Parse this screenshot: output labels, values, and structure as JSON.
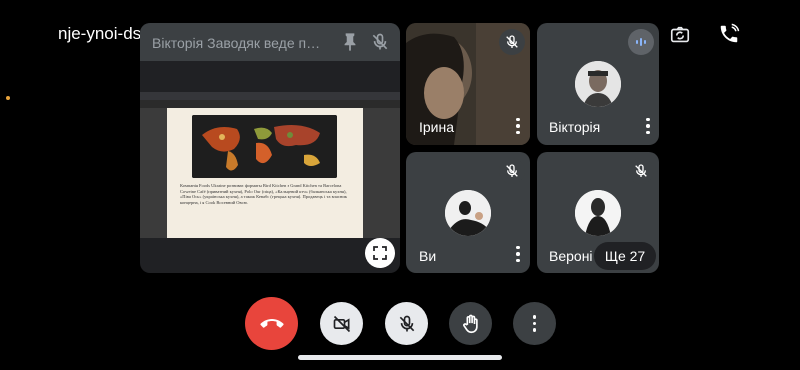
{
  "meeting": {
    "code": "nje-ynoi-dsk"
  },
  "presentation": {
    "title": "Вікторія Заводяк веде пр...",
    "pdf_text": "Компанія Foods Ukraine розвиває форматы Bird Kitchen з Grand Kitchen та Barcelona Coweine Café (приватний кухня), Polo Our (піца), «Кальцевий ктч» (балканська кухня), «Піва Ось» (українська кухня), а також Кевабс (грецька кухня). Продавець і та власник концерна, і я Cook Восевний Овсю."
  },
  "participants": [
    {
      "name": "Ірина",
      "muted": true
    },
    {
      "name": "Вікторія",
      "speaking": true
    },
    {
      "name": "Ви",
      "muted": true
    },
    {
      "name": "Вероні",
      "muted": true
    }
  ],
  "more_participants": "Ще 27",
  "icons": {
    "pin": "pin-icon",
    "mic_off": "mic-off-icon",
    "camera_switch": "camera-switch-icon",
    "audio": "phone-audio-icon",
    "fullscreen": "fullscreen-icon",
    "end_call": "end-call-icon",
    "camera_off": "camera-off-icon",
    "hand": "raise-hand-icon",
    "more": "more-options-icon"
  },
  "colors": {
    "end_call": "#e8453c",
    "speaking": "#8ab4f8"
  }
}
